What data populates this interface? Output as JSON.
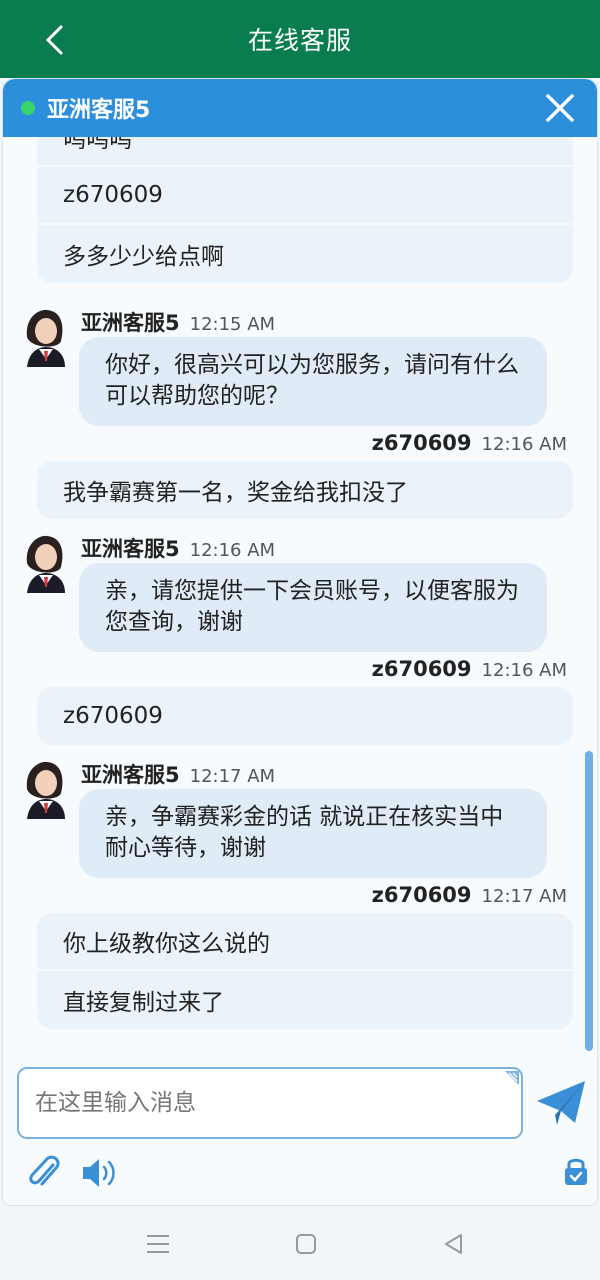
{
  "app": {
    "title": "在线客服"
  },
  "chat": {
    "agent_name": "亚洲客服5",
    "status_color": "#38d36b",
    "header_color": "#2b8fdc",
    "input_placeholder": "在这里输入消息"
  },
  "messages": {
    "group1": [
      "呜呜呜",
      "z670609",
      "多多少少给点啊"
    ],
    "m2": {
      "sender": "亚洲客服5",
      "time": "12:15 AM",
      "text": "你好，很高兴可以为您服务，请问有什么可以帮助您的呢？"
    },
    "m3": {
      "sender": "z670609",
      "time": "12:16 AM",
      "text": "我争霸赛第一名，奖金给我扣没了"
    },
    "m4": {
      "sender": "亚洲客服5",
      "time": "12:16 AM",
      "text": "亲，请您提供一下会员账号，以便客服为您查询，谢谢"
    },
    "m5": {
      "sender": "z670609",
      "time": "12:16 AM",
      "text": "z670609"
    },
    "m6": {
      "sender": "亚洲客服5",
      "time": "12:17 AM",
      "text": "亲，争霸赛彩金的话 就说正在核实当中 耐心等待，谢谢"
    },
    "m7": {
      "sender": "z670609",
      "time": "12:17 AM",
      "lines": [
        "你上级教你这么说的",
        "直接复制过来了"
      ]
    }
  },
  "icons": {
    "back": "chevron-left-icon",
    "close": "close-icon",
    "send": "paper-plane-icon",
    "attach": "paperclip-icon",
    "sound": "speaker-icon",
    "lock": "lock-icon"
  }
}
